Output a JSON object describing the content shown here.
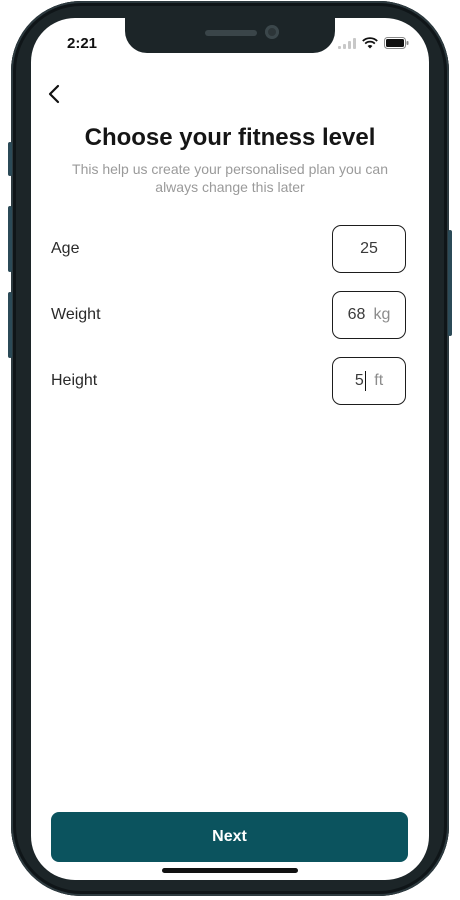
{
  "status_bar": {
    "time": "2:21"
  },
  "header": {
    "back_icon": "chevron-left-icon",
    "title": "Choose your fitness level",
    "subtitle": "This help us create your personalised plan you can always change this later"
  },
  "form": {
    "fields": [
      {
        "label": "Age",
        "value": "25",
        "unit": ""
      },
      {
        "label": "Weight",
        "value": "68",
        "unit": "kg"
      },
      {
        "label": "Height",
        "value": "5",
        "unit": "ft"
      }
    ]
  },
  "footer": {
    "next_label": "Next"
  },
  "colors": {
    "primary": "#0b535e",
    "frame": "#1c2528"
  }
}
